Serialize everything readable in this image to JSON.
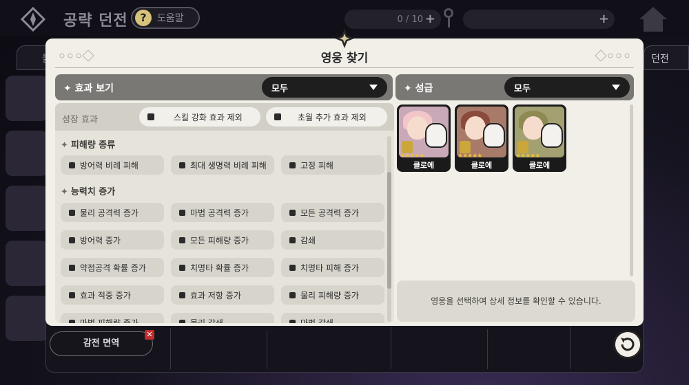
{
  "header": {
    "title": "공략 던전",
    "help_label": "도움말",
    "stamina_text": "0 / 10",
    "left_tab_label": "불",
    "right_tab_label": "던전"
  },
  "modal": {
    "title": "영웅 찾기",
    "effect_section": {
      "label": "✦ 효과 보기",
      "dropdown_value": "모두"
    },
    "grade_section": {
      "label": "✦ 성급",
      "dropdown_value": "모두"
    },
    "growth": {
      "label": "성장 효과",
      "toggle_1": "스킬 강화 효과 제외",
      "toggle_2": "초월 추가 효과 제외"
    },
    "categories": [
      {
        "label": "피해량 종류",
        "items": [
          "방어력 비례 피해",
          "최대 생명력 비례 피해",
          "고정 피해"
        ]
      },
      {
        "label": "능력치 증가",
        "items": [
          "물리 공격력 증가",
          "마법 공격력 증가",
          "모든 공격력 증가",
          "방어력 증가",
          "모든 피해량 증가",
          "감쇄",
          "약점공격 확률 증가",
          "치명타 확률 증가",
          "치명타 피해 증가",
          "효과 적중 증가",
          "효과 저항 증가",
          "물리 피해량 증가",
          "마법 피해량 증가",
          "물리 감쇄",
          "마법 감쇄"
        ]
      }
    ],
    "heroes": [
      {
        "name": "클로에",
        "hair_color": "#f2c6c8",
        "bg": "#c9a8b7"
      },
      {
        "name": "클로에",
        "hair_color": "#8a4a3c",
        "bg": "#a87a6a"
      },
      {
        "name": "클로에",
        "hair_color": "#8d8a52",
        "bg": "#a3a072"
      }
    ],
    "hero_stars": "★★★★★",
    "info_text": "영웅을 선택하여 상세 정보를 확인할 수 있습니다."
  },
  "footer": {
    "exempt_label": "감전 면역",
    "remove_icon": "✕"
  }
}
